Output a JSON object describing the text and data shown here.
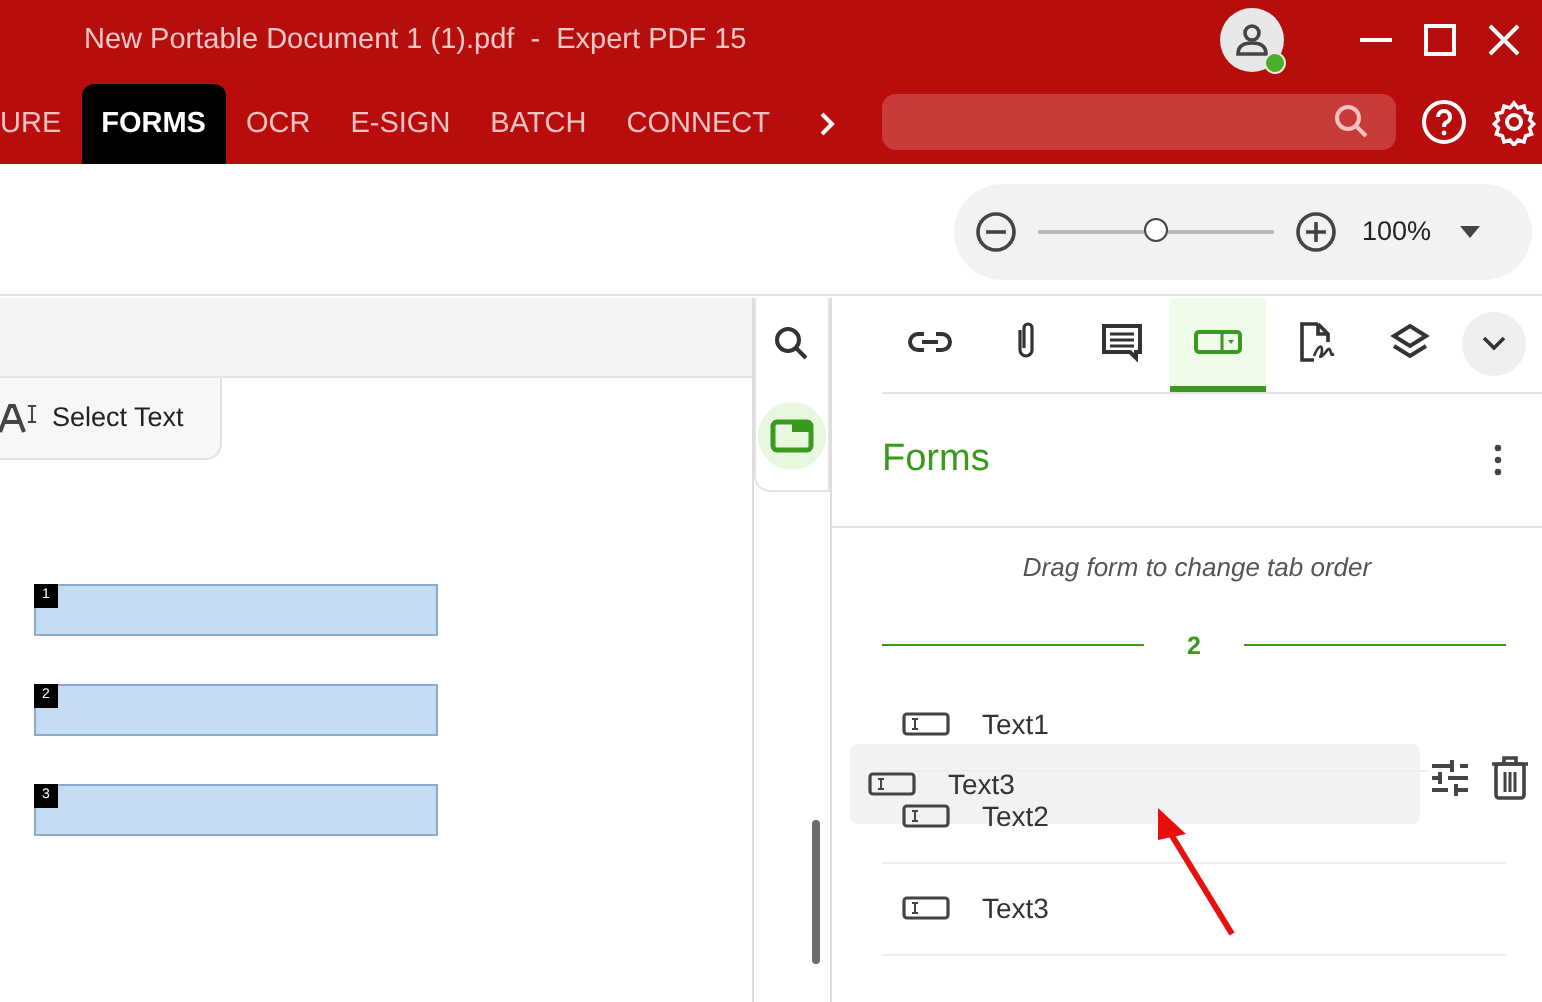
{
  "window": {
    "title": "New Portable Document 1 (1).pdf  -  Expert PDF 15"
  },
  "account": {
    "online": true
  },
  "ribbon_tabs": [
    {
      "label": "URE",
      "selected": false
    },
    {
      "label": "FORMS",
      "selected": true
    },
    {
      "label": "OCR",
      "selected": false
    },
    {
      "label": "E-SIGN",
      "selected": false
    },
    {
      "label": "BATCH",
      "selected": false
    },
    {
      "label": "CONNECT",
      "selected": false
    }
  ],
  "zoom": {
    "level": 0.5,
    "reading": "100%"
  },
  "document": {
    "tool_tab": "Select Text",
    "fields": [
      {
        "number": "1"
      },
      {
        "number": "2"
      },
      {
        "number": "3"
      }
    ]
  },
  "side_tools": [
    {
      "kind": "search",
      "selected": false
    },
    {
      "kind": "forms",
      "selected": true
    }
  ],
  "panel": {
    "tabs": [
      {
        "kind": "link",
        "selected": false
      },
      {
        "kind": "attachment",
        "selected": false
      },
      {
        "kind": "comment",
        "selected": false
      },
      {
        "kind": "form",
        "selected": true
      },
      {
        "kind": "signature",
        "selected": false
      },
      {
        "kind": "layers",
        "selected": false
      }
    ],
    "title": "Forms",
    "hint": "Drag form to change tab order",
    "page_separator": "2",
    "items": [
      {
        "name": "Text1"
      },
      {
        "name": "Text2"
      },
      {
        "name": "Text3"
      }
    ],
    "dragged": {
      "name": "Text3"
    }
  }
}
